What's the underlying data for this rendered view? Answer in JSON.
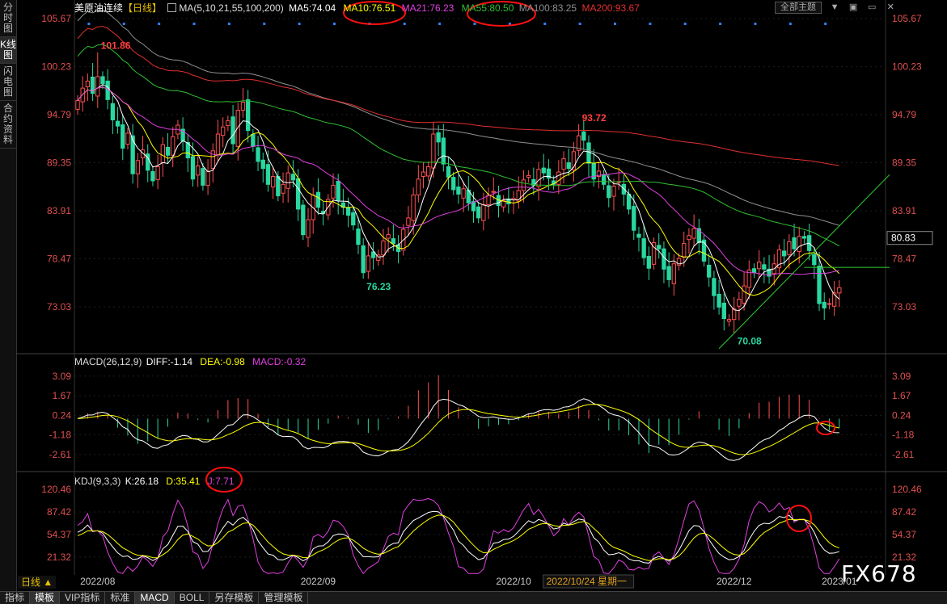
{
  "leftbar": [
    {
      "label": "分时图",
      "active": false
    },
    {
      "label": "K线图",
      "active": true
    },
    {
      "label": "闪电图",
      "active": false
    },
    {
      "label": "合约资料",
      "active": false
    }
  ],
  "top": {
    "title": "美原油连续",
    "period_tag": "【日线】",
    "ma_label": "MA(5,10,21,55,100,200)",
    "ma5": "MA5:74.04",
    "ma10": "MA10:76.51",
    "ma21": "MA21:76.23",
    "ma55": "MA55:80.50",
    "ma100": "MA100:83.25",
    "ma200": "MA200:93.67",
    "theme_button": "全部主题",
    "window_buttons": [
      "▼",
      "▣",
      "▭",
      "✕"
    ]
  },
  "macd_legend": {
    "name": "MACD(26,12,9)",
    "diff": "DIFF:-1.14",
    "dea": "DEA:-0.98",
    "macd": "MACD:-0.32"
  },
  "kdj_legend": {
    "name": "KDJ(9,3,3)",
    "k": "K:26.18",
    "d": "D:35.41",
    "j": "J:7.71"
  },
  "bottom": {
    "period_button": "日线 ▲",
    "tabs": [
      "指标",
      "模板",
      "VIP指标",
      "标准",
      "MACD",
      "BOLL",
      "另存模板",
      "管理模板"
    ],
    "active_tabs": [
      "模板",
      "MACD"
    ],
    "watermark": "FX678"
  },
  "colors": {
    "up": "#ff5050",
    "down": "#29d7a0",
    "ma5": "#ffffff",
    "ma10": "#ffff00",
    "ma21": "#e040e0",
    "ma55": "#30c030",
    "ma100": "#909090",
    "ma200": "#e03030",
    "annotation_circle": "#ff1010",
    "trendline": "#30d030",
    "date_highlight": "#e0a020"
  },
  "chart_data": [
    {
      "type": "candlestick",
      "title": "美原油连续 日线",
      "yticks": [
        "105.67",
        "100.23",
        "94.79",
        "89.35",
        "83.91",
        "78.47",
        "73.03"
      ],
      "ylim": [
        68.0,
        106.5
      ],
      "last_price": "80.83",
      "xticks": [
        "2022/08",
        "2022/09",
        "2022/10",
        "2022/12",
        "2023/01"
      ],
      "highlighted_date": "2022/10/24 星期一",
      "annotations": [
        {
          "text": "101.86",
          "value": 101.86,
          "kind": "high",
          "index": 4
        },
        {
          "text": "76.23",
          "value": 76.23,
          "kind": "low",
          "index": 57
        },
        {
          "text": "93.72",
          "value": 93.72,
          "kind": "high",
          "index": 100
        },
        {
          "text": "70.08",
          "value": 70.08,
          "kind": "low",
          "index": 131
        }
      ],
      "closes": [
        96.4,
        97.8,
        98.6,
        97.2,
        99.1,
        98.3,
        96.5,
        94.2,
        93.5,
        91.0,
        92.7,
        88.1,
        89.6,
        90.8,
        88.5,
        87.3,
        88.9,
        91.4,
        90.2,
        92.3,
        93.6,
        91.8,
        89.9,
        87.5,
        89.0,
        86.8,
        88.4,
        90.7,
        92.6,
        93.4,
        94.1,
        91.5,
        95.3,
        96.2,
        93.0,
        91.2,
        89.5,
        88.7,
        86.9,
        87.8,
        85.6,
        86.9,
        88.2,
        87.4,
        84.1,
        81.2,
        82.9,
        85.7,
        84.3,
        83.6,
        85.2,
        86.8,
        85.1,
        84.3,
        83.4,
        82.3,
        80.1,
        76.9,
        78.8,
        78.6,
        78.9,
        80.5,
        81.2,
        80.2,
        79.3,
        81.8,
        83.1,
        85.7,
        87.5,
        88.3,
        88.9,
        92.6,
        91.7,
        89.2,
        87.7,
        86.3,
        85.8,
        86.4,
        84.8,
        83.9,
        83.1,
        84.6,
        85.7,
        86.1,
        84.5,
        85.1,
        84.7,
        85.3,
        86.2,
        87.4,
        87.9,
        86.8,
        88.6,
        88.2,
        87.6,
        86.9,
        88.3,
        89.8,
        88.7,
        90.6,
        92.4,
        91.9,
        89.3,
        87.5,
        88.4,
        86.9,
        85.4,
        86.7,
        87.2,
        85.8,
        84.1,
        81.7,
        80.9,
        78.6,
        77.4,
        80.3,
        79.6,
        77.3,
        76.1,
        77.9,
        78.5,
        80.2,
        81.1,
        81.9,
        80.3,
        78.2,
        76.4,
        74.3,
        73.0,
        71.7,
        71.6,
        72.8,
        73.9,
        75.4,
        77.2,
        76.9,
        78.1,
        77.3,
        76.5,
        77.9,
        79.5,
        78.8,
        80.4,
        79.6,
        81.0,
        80.8,
        79.4,
        77.8,
        73.4,
        72.9,
        73.4,
        74.6,
        75.2
      ]
    },
    {
      "type": "line",
      "title": "MACD(26,12,9)",
      "yticks": [
        "3.09",
        "1.67",
        "0.24",
        "-1.18",
        "-2.61"
      ],
      "ylim": [
        -3.5,
        3.9
      ],
      "series": [
        {
          "name": "DIFF",
          "value": -1.14
        },
        {
          "name": "DEA",
          "value": -0.98
        },
        {
          "name": "MACD",
          "value": -0.32
        }
      ]
    },
    {
      "type": "line",
      "title": "KDJ(9,3,3)",
      "yticks": [
        "120.46",
        "87.42",
        "54.37",
        "21.32"
      ],
      "ylim": [
        -5,
        130
      ],
      "series": [
        {
          "name": "K",
          "value": 26.18
        },
        {
          "name": "D",
          "value": 35.41
        },
        {
          "name": "J",
          "value": 7.71
        }
      ]
    }
  ]
}
